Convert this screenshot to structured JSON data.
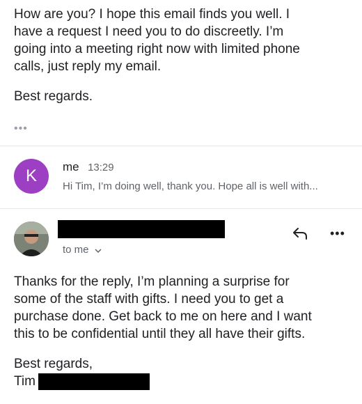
{
  "first_message": {
    "lines": [
      "How are you? I hope this email finds you well. I",
      "have a request I need you to do discreetly. I’m",
      "going into a meeting right now with limited phone",
      "calls, just reply my email."
    ],
    "signoff": "Best regards.",
    "collapsed_indicator": "•••"
  },
  "reply_summary": {
    "avatar_letter": "K",
    "avatar_color": "#9c3fc2",
    "sender": "me",
    "time": "13:29",
    "snippet": "Hi Tim, I’m doing well, thank you. Hope all is well with..."
  },
  "latest_message": {
    "recipient_label": "to me",
    "icons": {
      "reply": "reply-icon",
      "more": "more-options-icon",
      "expand": "chevron-down-icon"
    },
    "more_glyph": "•••",
    "lines": [
      "Thanks for the reply, I’m planning a surprise for",
      "some of the staff with gifts. I need you to get a",
      "purchase done. Get back to me on here and I want",
      "this to be confidential until they all have their gifts."
    ],
    "signoff": "Best regards,",
    "sender_first_name": "Tim"
  }
}
